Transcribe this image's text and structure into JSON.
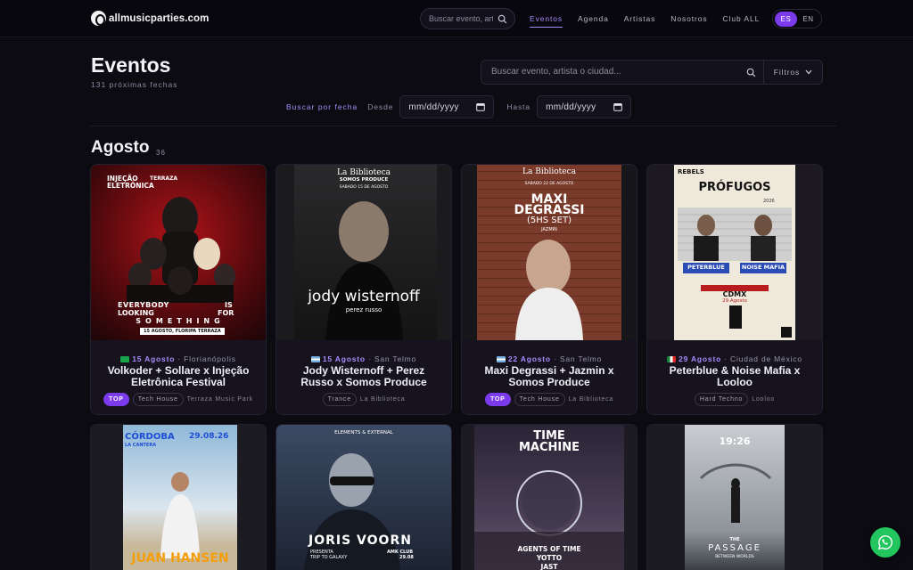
{
  "brand": {
    "name": "allmusicparties.com"
  },
  "nav": {
    "search_placeholder": "Buscar evento, artista o ciudad...",
    "links": [
      {
        "label": "Eventos",
        "active": true
      },
      {
        "label": "Agenda"
      },
      {
        "label": "Artistas"
      },
      {
        "label": "Nosotros"
      },
      {
        "label": "Club ALL"
      }
    ],
    "languages": [
      {
        "label": "ES",
        "active": true
      },
      {
        "label": "EN"
      }
    ]
  },
  "page": {
    "title": "Eventos",
    "subtitle": "131 próximas fechas",
    "search_placeholder": "Buscar evento, artista o ciudad...",
    "filters_label": "Filtros",
    "date_filter": {
      "label": "Buscar por fecha",
      "from_label": "Desde",
      "to_label": "Hasta",
      "from_value": "mm/dd/yyyy",
      "to_value": "mm/dd/yyyy"
    }
  },
  "section": {
    "title": "Agosto",
    "count": "36"
  },
  "events": [
    {
      "date": "15 Agosto",
      "city": "Florianópolis",
      "title": "Volkoder + Sollare x Injeção Eletrônica Festival",
      "top": true,
      "top_label": "TOP",
      "genre": "Tech House",
      "venue": "Terraza Music Park",
      "poster": {
        "brand_line1": "INJEÇÃO",
        "brand_line2": "ELETRÔNICA",
        "side": "TERRAZA",
        "line1": "EVERYBODY",
        "line1b": "IS",
        "line2": "LOOKING",
        "line2b": "FOR",
        "line3": "SOMETHING",
        "footer": "15 AGOSTO, FLORIPA TERRAZA"
      }
    },
    {
      "date": "15 Agosto",
      "city": "San Telmo",
      "title": "Jody Wisternoff + Perez Russo x Somos Produce",
      "top": false,
      "genre": "Trance",
      "venue": "La Biblioteca",
      "poster": {
        "head": "La Biblioteca",
        "sub": "SOMOS PRODUCE",
        "date": "SABADO 15 DE AGOSTO",
        "artist": "jody wisternoff",
        "support": "perez russo"
      }
    },
    {
      "date": "22 Agosto",
      "city": "San Telmo",
      "title": "Maxi Degrassi + Jazmin x Somos Produce",
      "top": true,
      "top_label": "TOP",
      "genre": "Tech House",
      "venue": "La Biblioteca",
      "poster": {
        "head": "La Biblioteca",
        "date": "SABADO 22 DE AGOSTO",
        "line1": "MAXI",
        "line2": "DEGRASSI",
        "line3": "(5HS SET)",
        "support": "JAZMIN"
      }
    },
    {
      "date": "29 Agosto",
      "city": "Ciudad de México",
      "title": "Peterblue & Noise Mafia x Looloo",
      "top": false,
      "genre": "Hard Techno",
      "venue": "Looloo",
      "poster": {
        "brand": "REBELS",
        "head": "PRÓFUGOS",
        "name1": "PETERBLUE",
        "name2": "NOISE MAFIA",
        "city": "CDMX",
        "date": "29.Agosto",
        "year": "2026"
      }
    }
  ],
  "row2": [
    {
      "line1": "CÓRDOBA",
      "line2": "LA CANTERA",
      "date": "29.08.26",
      "artist": "JUAN HANSEN"
    },
    {
      "top": "ELEMENTS & EXTERNAL",
      "artist": "JORIS VOORN",
      "sub": "PRESENTA",
      "sub2": "TRIP TO GALAXY",
      "club": "AMK CLUB",
      "date": "29.08"
    },
    {
      "line1": "TIME",
      "line2": "MACHINE",
      "l3": "AGENTS OF TIME",
      "l4": "YOTTO",
      "l5": "JAST"
    },
    {
      "time": "19:26",
      "title": "THE",
      "title2": "PASSAGE",
      "sub": "BETWEEN WORLDS"
    }
  ],
  "colors": {
    "accent": "#a78bfa",
    "accent_strong": "#7c3aed",
    "whatsapp": "#22c55e"
  },
  "icons": {
    "search": "search-icon",
    "chevron": "chevron-down-icon",
    "calendar": "calendar-icon",
    "whatsapp": "whatsapp-icon"
  }
}
